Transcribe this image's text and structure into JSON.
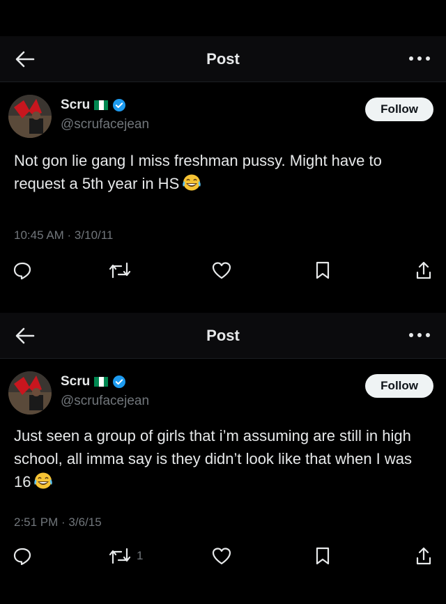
{
  "posts": [
    {
      "header": {
        "title": "Post"
      },
      "author": {
        "name": "Scru",
        "handle": "@scrufacejean",
        "follow_label": "Follow"
      },
      "text": "Not gon lie gang I miss freshman pussy. Might have to request a 5th year in HS",
      "emoji": "face-with-tears-of-joy",
      "timestamp": "10:45 AM · 3/10/11",
      "actions": {
        "reposts": ""
      }
    },
    {
      "header": {
        "title": "Post"
      },
      "author": {
        "name": "Scru",
        "handle": "@scrufacejean",
        "follow_label": "Follow"
      },
      "text": "Just seen a group of girls that i’m assuming are still in high school, all imma say is they didn’t look like that when I was 16",
      "emoji": "face-with-tears-of-joy",
      "timestamp": "2:51 PM · 3/6/15",
      "actions": {
        "reposts": "1"
      }
    }
  ],
  "colors": {
    "background": "#000000",
    "verified": "#1d9bf0",
    "muted": "#71767b",
    "text": "#e7e9ea",
    "flag_green": "#008751"
  }
}
